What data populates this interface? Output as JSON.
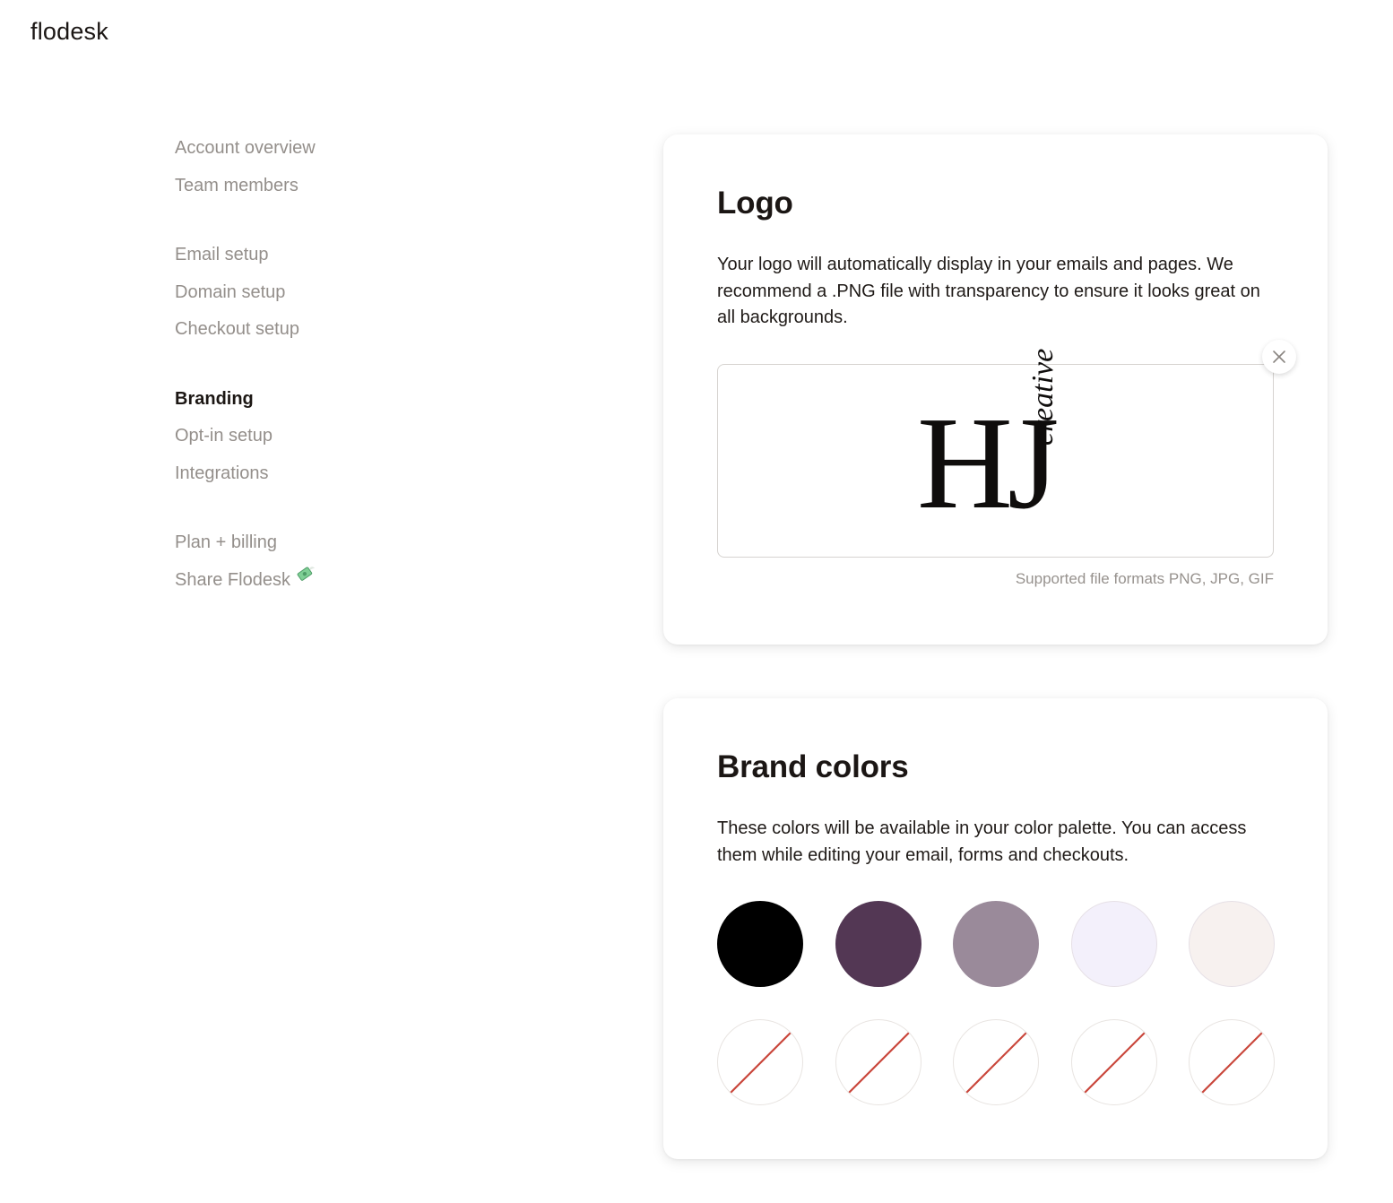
{
  "app": {
    "brand": "flodesk"
  },
  "sidebar": {
    "groups": [
      {
        "items": [
          {
            "label": "Account overview"
          },
          {
            "label": "Team members"
          }
        ]
      },
      {
        "items": [
          {
            "label": "Email setup"
          },
          {
            "label": "Domain setup"
          },
          {
            "label": "Checkout setup"
          }
        ]
      },
      {
        "items": [
          {
            "label": "Branding",
            "active": true
          },
          {
            "label": "Opt-in setup"
          },
          {
            "label": "Integrations"
          }
        ]
      },
      {
        "items": [
          {
            "label": "Plan + billing"
          },
          {
            "label": "Share Flodesk",
            "icon": "money-with-wings-icon"
          }
        ]
      }
    ]
  },
  "logo_section": {
    "title": "Logo",
    "description": "Your logo will automatically display in your emails and pages. We recommend a .PNG file with transparency to ensure it looks great on all backgrounds.",
    "logo_mark": "HJ",
    "logo_script": "creative",
    "remove_icon": "close-icon",
    "formats_note": "Supported file formats PNG, JPG, GIF"
  },
  "colors_section": {
    "title": "Brand colors",
    "description": "These colors will be available in your color palette. You can access them while editing your email, forms and checkouts.",
    "swatches": [
      "#000000",
      "#533754",
      "#9a8a9a",
      "#f3f0fb",
      "#f7f1ef"
    ],
    "empty_slots": 5,
    "empty_slot_icon": "no-color-icon",
    "empty_slash_color": "#c9463b"
  }
}
